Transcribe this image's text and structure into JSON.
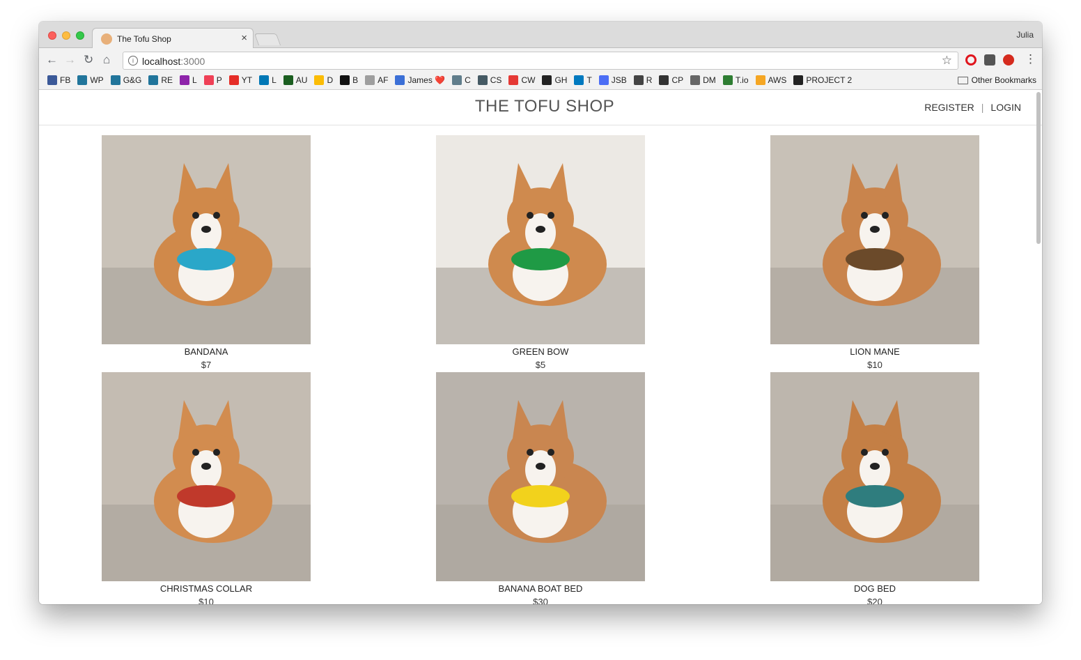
{
  "browser": {
    "tab_title": "The Tofu Shop",
    "tab_close": "×",
    "profile_name": "Julia",
    "url_host": "localhost",
    "url_port": ":3000",
    "back_icon": "arrow-left-icon",
    "forward_icon": "arrow-right-icon",
    "reload_icon": "reload-icon",
    "home_icon": "home-icon",
    "star_icon": "star-icon"
  },
  "bookmarks": [
    {
      "label": "FB",
      "color": "#3b5998"
    },
    {
      "label": "WP",
      "color": "#21759b"
    },
    {
      "label": "G&G",
      "color": "#21759b"
    },
    {
      "label": "RE",
      "color": "#21759b"
    },
    {
      "label": "L",
      "color": "#8e24aa"
    },
    {
      "label": "P",
      "color": "#ef4056"
    },
    {
      "label": "YT",
      "color": "#e52d27"
    },
    {
      "label": "L",
      "color": "#0077b5"
    },
    {
      "label": "AU",
      "color": "#1b5e20"
    },
    {
      "label": "D",
      "color": "#fbbc05"
    },
    {
      "label": "B",
      "color": "#111111"
    },
    {
      "label": "AF",
      "color": "#9e9e9e"
    },
    {
      "label": "James ❤️",
      "color": "#3b6fd6"
    },
    {
      "label": "C",
      "color": "#607d8b"
    },
    {
      "label": "CS",
      "color": "#455a64"
    },
    {
      "label": "CW",
      "color": "#e53935"
    },
    {
      "label": "GH",
      "color": "#222222"
    },
    {
      "label": "T",
      "color": "#0079bf"
    },
    {
      "label": "JSB",
      "color": "#4c6ef5"
    },
    {
      "label": "R",
      "color": "#444444"
    },
    {
      "label": "CP",
      "color": "#333333"
    },
    {
      "label": "DM",
      "color": "#666666"
    },
    {
      "label": "T.io",
      "color": "#2e7d32"
    },
    {
      "label": "AWS",
      "color": "#f5a623"
    },
    {
      "label": "PROJECT 2",
      "color": "#222222"
    }
  ],
  "bookmarks_other": "Other Bookmarks",
  "site": {
    "title": "THE TOFU SHOP",
    "nav_register": "REGISTER",
    "nav_separator": "|",
    "nav_login": "LOGIN"
  },
  "products": [
    {
      "name": "BANDANA",
      "price": "$7",
      "bg": "#c9c2b8",
      "accent": "#2aa7c9",
      "dog": "#d0894a"
    },
    {
      "name": "GREEN BOW",
      "price": "$5",
      "bg": "#ece9e4",
      "accent": "#1f9a45",
      "dog": "#cf8a4e"
    },
    {
      "name": "LION MANE",
      "price": "$10",
      "bg": "#c8c1b7",
      "accent": "#6b4a2a",
      "dog": "#c9844c"
    },
    {
      "name": "CHRISTMAS COLLAR",
      "price": "$10",
      "bg": "#c4bcb2",
      "accent": "#c0392b",
      "dog": "#d28c4f"
    },
    {
      "name": "BANANA BOAT BED",
      "price": "$30",
      "bg": "#b9b3ac",
      "accent": "#f2d21c",
      "dog": "#c98650"
    },
    {
      "name": "DOG BED",
      "price": "$20",
      "bg": "#bdb6ad",
      "accent": "#2f7d7e",
      "dog": "#c47f45"
    }
  ]
}
